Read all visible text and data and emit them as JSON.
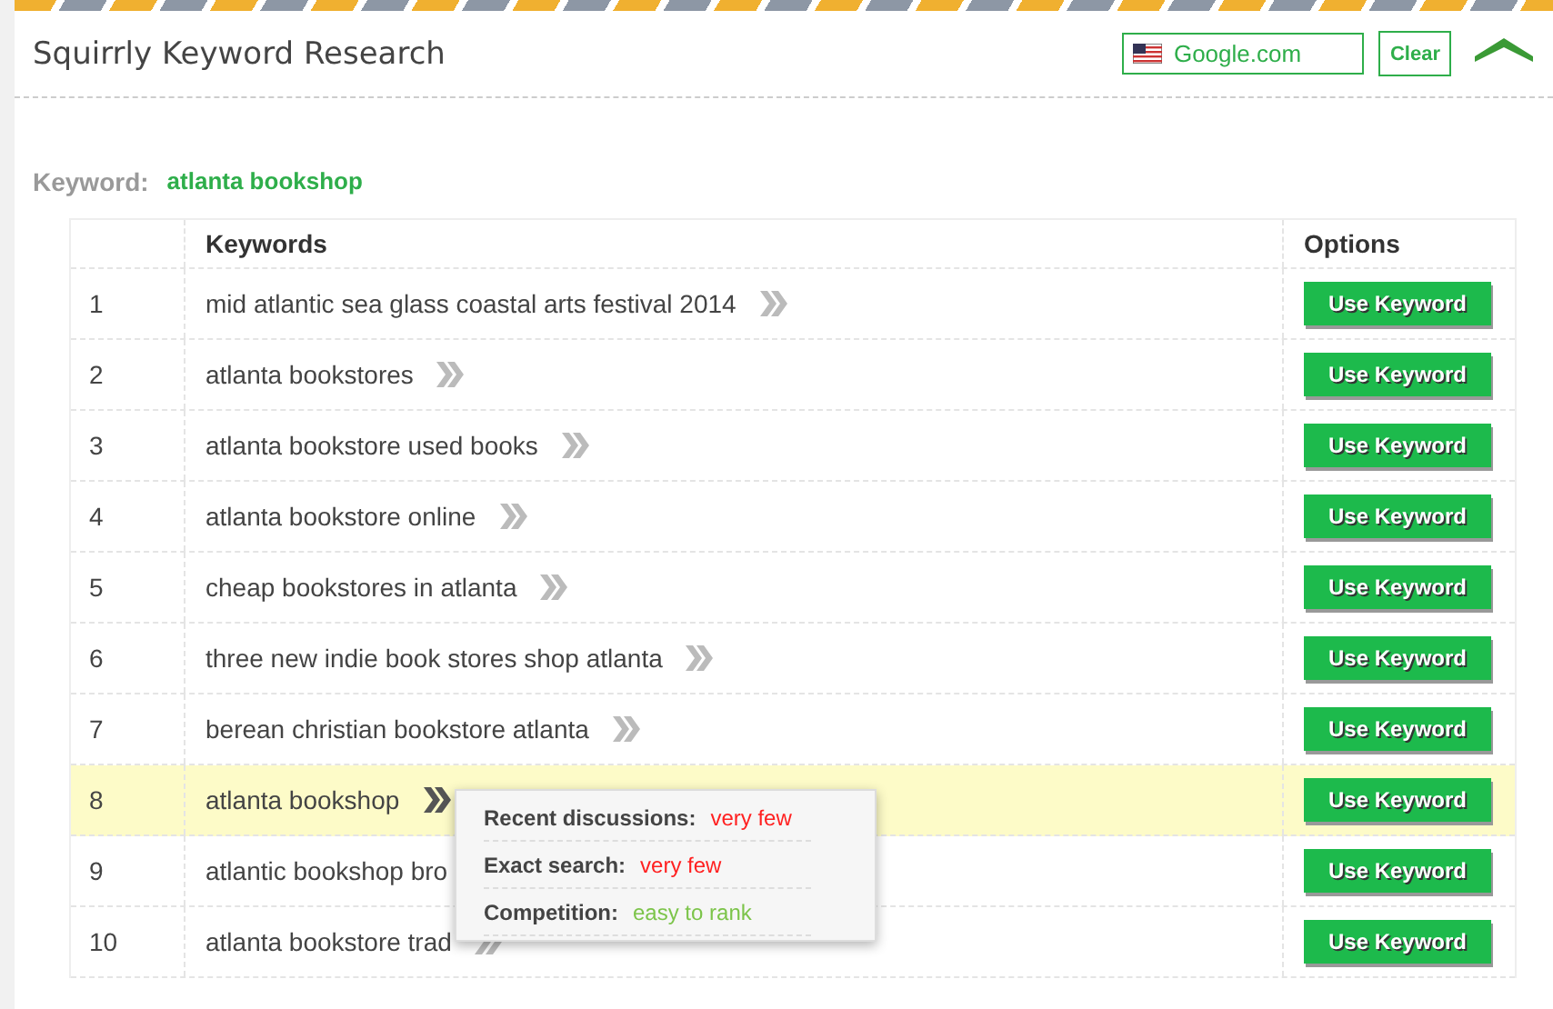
{
  "header": {
    "title": "Squirrly Keyword Research",
    "engine": "Google.com",
    "clear_button": "Clear"
  },
  "keyword": {
    "label": "Keyword:",
    "value": "atlanta bookshop"
  },
  "table": {
    "columns": [
      "Keywords",
      "Options"
    ],
    "rows": [
      {
        "number": "1",
        "keyword": "mid atlantic sea glass coastal arts festival 2014",
        "selected": false,
        "button": "Use Keyword"
      },
      {
        "number": "2",
        "keyword": "atlanta bookstores",
        "selected": false,
        "button": "Use Keyword"
      },
      {
        "number": "3",
        "keyword": "atlanta bookstore used books",
        "selected": false,
        "button": "Use Keyword"
      },
      {
        "number": "4",
        "keyword": "atlanta bookstore online",
        "selected": false,
        "button": "Use Keyword"
      },
      {
        "number": "5",
        "keyword": "cheap bookstores in atlanta",
        "selected": false,
        "button": "Use Keyword"
      },
      {
        "number": "6",
        "keyword": "three new indie book stores shop atlanta",
        "selected": false,
        "button": "Use Keyword"
      },
      {
        "number": "7",
        "keyword": "berean christian bookstore atlanta",
        "selected": false,
        "button": "Use Keyword"
      },
      {
        "number": "8",
        "keyword": "atlanta bookshop",
        "selected": true,
        "button": "Use Keyword"
      },
      {
        "number": "9",
        "keyword": "atlantic bookshop bro",
        "selected": false,
        "button": "Use Keyword"
      },
      {
        "number": "10",
        "keyword": "atlanta bookstore trad",
        "selected": false,
        "button": "Use Keyword"
      }
    ]
  },
  "tooltip": {
    "items": [
      {
        "label": "Recent discussions:",
        "value": "very few",
        "color": "#ff2020"
      },
      {
        "label": "Exact search:",
        "value": "very few",
        "color": "#ff2020"
      },
      {
        "label": "Competition:",
        "value": "easy to rank",
        "color": "#7cc44a"
      }
    ]
  }
}
